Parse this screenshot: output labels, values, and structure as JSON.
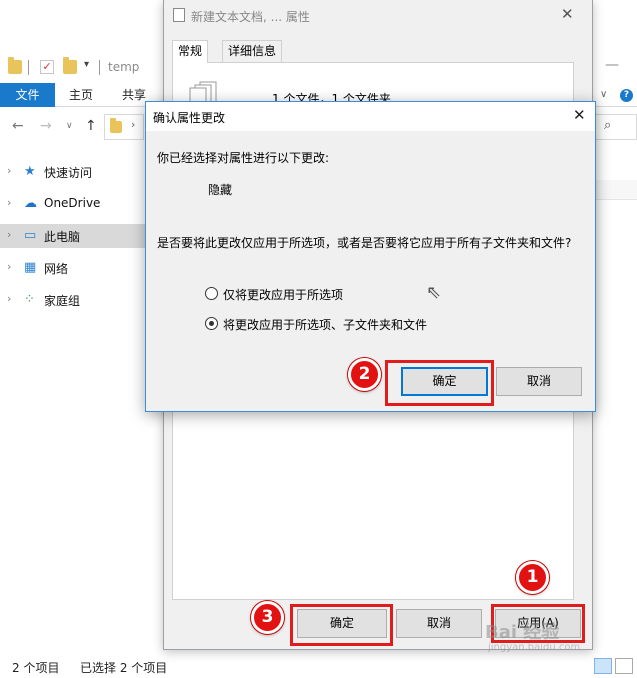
{
  "explorer": {
    "window_title": "temp",
    "ribbon": {
      "file_tab": "文件",
      "home_tab": "主页",
      "share_tab": "共享"
    },
    "nav": [
      {
        "label": "快速访问",
        "icon": "star-icon"
      },
      {
        "label": "OneDrive",
        "icon": "cloud-icon"
      },
      {
        "label": "此电脑",
        "icon": "computer-icon",
        "selected": true
      },
      {
        "label": "网络",
        "icon": "network-icon"
      },
      {
        "label": "家庭组",
        "icon": "homegroup-icon"
      }
    ],
    "status": {
      "count": "2 个项目",
      "selected": "已选择 2 个项目"
    }
  },
  "properties": {
    "title": "新建文本文档, ... 属性",
    "tabs": [
      "常规",
      "详细信息"
    ],
    "file_count": "1 个文件，1 个文件夹",
    "buttons": {
      "ok": "确定",
      "cancel": "取消",
      "apply": "应用(A)"
    }
  },
  "confirm": {
    "title": "确认属性更改",
    "intro": "你已经选择对属性进行以下更改:",
    "change": "隐藏",
    "question": "是否要将此更改仅应用于所选项，或者是否要将它应用于所有子文件夹和文件?",
    "option_selected_only": "仅将更改应用于所选项",
    "option_all": "将更改应用于所选项、子文件夹和文件",
    "selected_option": "option_all",
    "buttons": {
      "ok": "确定",
      "cancel": "取消"
    }
  },
  "annotations": {
    "step1": "1",
    "step2": "2",
    "step3": "3",
    "color": "#e01c1c"
  },
  "watermark": {
    "main": "Bai 经验",
    "sub": "jingyan.baidu.com"
  }
}
